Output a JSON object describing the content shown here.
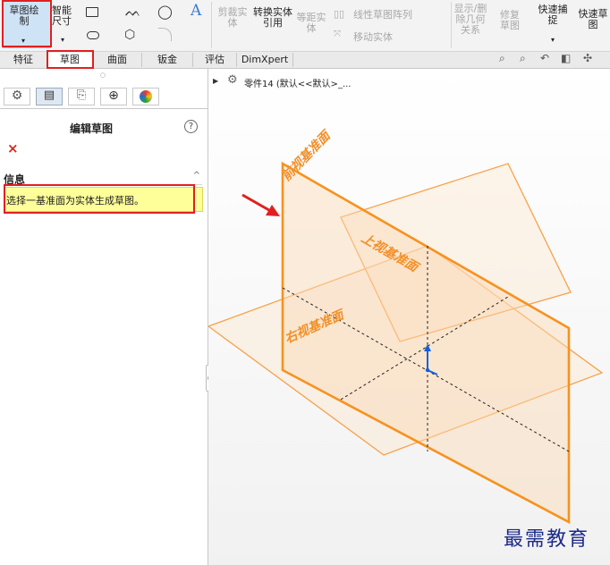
{
  "ribbon": {
    "sketch_label": "草图绘制",
    "smart_dim_label": "智能尺寸",
    "trim_label": "剪裁实体",
    "convert_label": "转换实体引用",
    "offset_label": "等距实体",
    "linear_pattern_label": "线性草图阵列",
    "move_label": "移动实体",
    "display_delete_label": "显示/删除几何关系",
    "repair_label": "修复草图",
    "quick_snap_label": "快速捕捉",
    "quick_sketch_label": "快速草图"
  },
  "tabs": [
    "特征",
    "草图",
    "曲面",
    "钣金",
    "评估",
    "DimXpert"
  ],
  "tree": {
    "part_label": "零件14 (默认<<默认>_..."
  },
  "panel": {
    "title": "编辑草图",
    "help": "?",
    "close": "×",
    "info_header": "信息",
    "info_message": "选择一基准面为实体生成草图。"
  },
  "planes": {
    "front": "前视基准面",
    "top": "上视基准面",
    "right": "右视基准面"
  },
  "watermark": "最需教育",
  "colors": {
    "accent_red": "#e02020",
    "plane_orange": "#f7921e",
    "info_yellow": "#ffff99"
  }
}
